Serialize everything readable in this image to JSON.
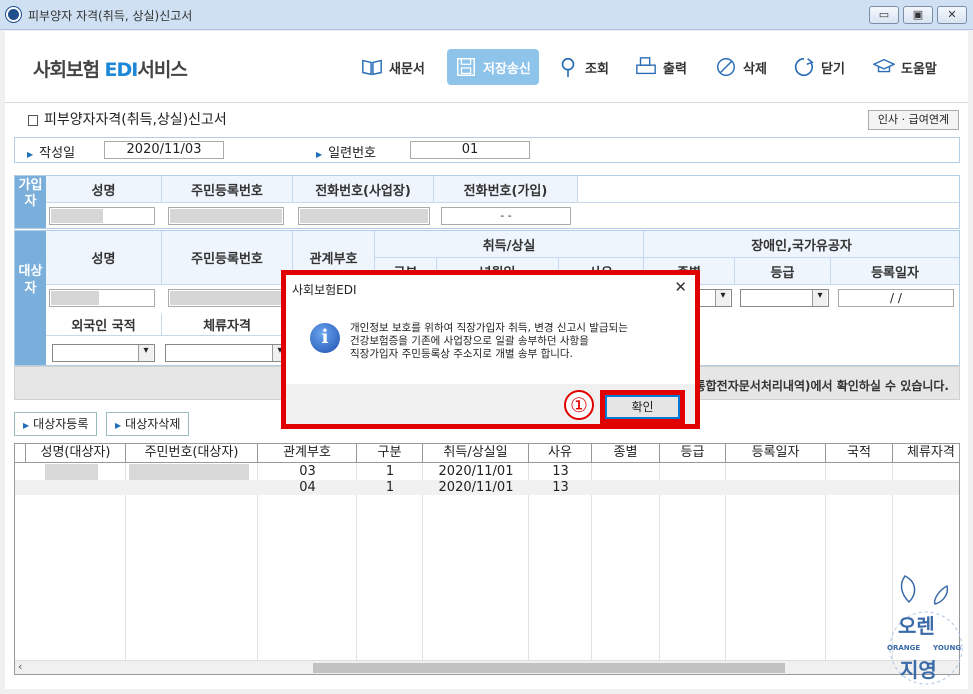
{
  "window": {
    "title": "피부양자 자격(취득, 상실)신고서"
  },
  "toolbar": {
    "brand_main": "사회보험 ",
    "brand_edi": "EDI",
    "brand_tail": "서비스",
    "buttons": [
      {
        "label": "새문서",
        "icon": "book-icon"
      },
      {
        "label": "저장송신",
        "icon": "save-icon"
      },
      {
        "label": "조회",
        "icon": "search-icon"
      },
      {
        "label": "출력",
        "icon": "printer-icon"
      },
      {
        "label": "삭제",
        "icon": "delete-icon"
      },
      {
        "label": "닫기",
        "icon": "close-icon"
      },
      {
        "label": "도움말",
        "icon": "help-icon"
      }
    ]
  },
  "form": {
    "title": "피부양자자격(취득,상실)신고서",
    "link_button": "인사 · 급여연계",
    "date_label": "작성일",
    "date_value": "2020/11/03",
    "serial_label": "일련번호",
    "serial_value": "01"
  },
  "subscriber": {
    "side_label": "가입자",
    "headers": [
      "성명",
      "주민등록번호",
      "전화번호(사업장)",
      "전화번호(가입)"
    ],
    "phone_value": "-      -"
  },
  "dependent": {
    "side_label": "대상자",
    "headers": [
      "성명",
      "주민등록번호",
      "관계부호",
      "취득/상실",
      "장애인,국가유공자"
    ],
    "sub_headers": [
      "구분",
      "년월일",
      "사유",
      "종별",
      "등급",
      "등록일자"
    ],
    "date_value": "/ /",
    "row2_headers": [
      "외국인 국적",
      "체류자격"
    ]
  },
  "notice": {
    "text": "통합전자문서처리내역)에서 확인하실 수 있습니다."
  },
  "actions": {
    "register": "대상자등록",
    "delete": "대상자삭제"
  },
  "list": {
    "columns": [
      "성명(대상자)",
      "주민번호(대상자)",
      "관계부호",
      "구분",
      "취득/상실일",
      "사유",
      "종별",
      "등급",
      "등록일자",
      "국적",
      "체류자격"
    ],
    "rows": [
      {
        "relation": "03",
        "type": "1",
        "date": "2020/11/01",
        "reason": "13"
      },
      {
        "relation": "04",
        "type": "1",
        "date": "2020/11/01",
        "reason": "13"
      }
    ]
  },
  "dialog": {
    "title": "사회보험EDI",
    "lines": [
      "개인정보 보호를 위하여 직장가입자 취득, 변경 신고시 발급되는",
      "건강보험증을 기존에 사업장으로 일괄 송부하던 사항을",
      "직장가입자 주민등록상 주소지로 개별 송부 합니다."
    ],
    "ok": "확인",
    "step_marker": "①"
  },
  "watermark": {
    "line1": "오렌",
    "line2": "지영",
    "sub_left": "ORANGE",
    "sub_right": "YOUNG"
  }
}
